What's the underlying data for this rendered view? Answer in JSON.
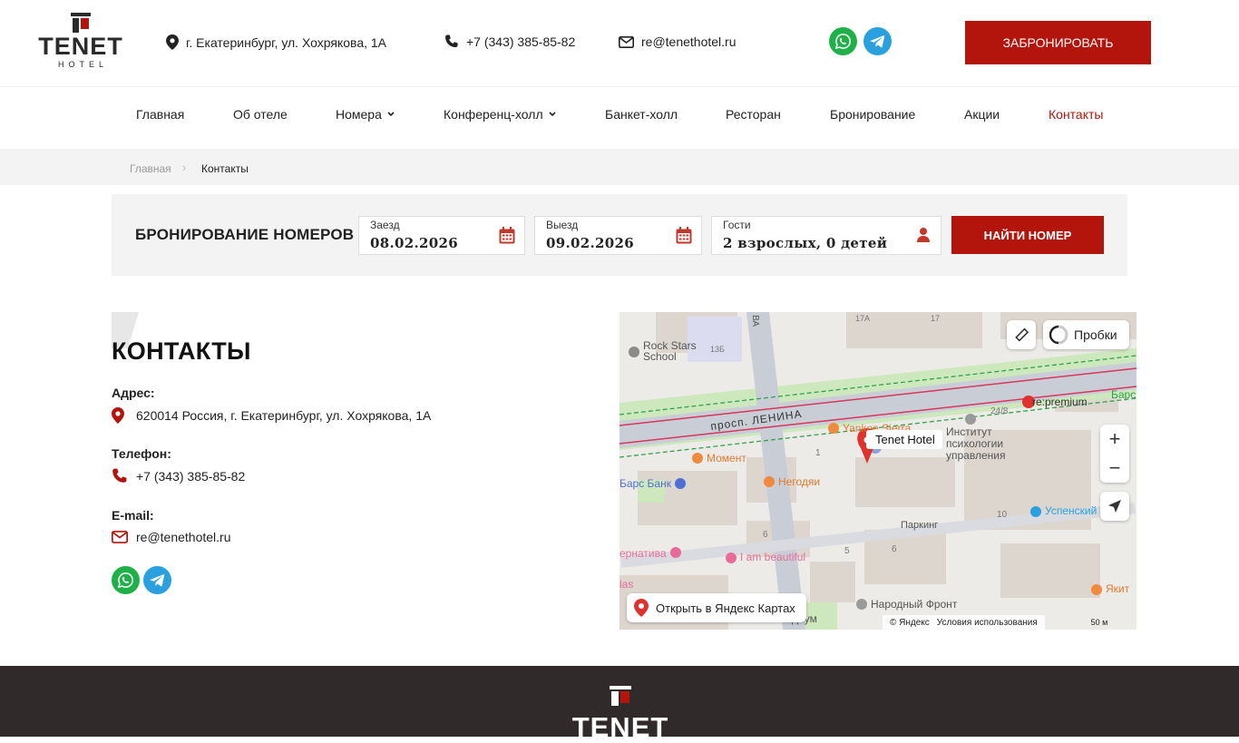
{
  "header": {
    "logo_word": "TENET",
    "logo_sub": "HOTEL",
    "address": "г. Екатеринбург, ул. Хохрякова, 1А",
    "phone": "+7 (343) 385-85-82",
    "email": "re@tenethotel.ru",
    "book_label": "ЗАБРОНИРОВАТЬ",
    "icons": [
      "map-pin-icon",
      "phone-icon",
      "mail-icon",
      "whatsapp-icon",
      "telegram-icon"
    ]
  },
  "nav": {
    "items": [
      {
        "label": "Главная"
      },
      {
        "label": "Об отеле"
      },
      {
        "label": "Номера"
      },
      {
        "label": "Конференц-холл"
      },
      {
        "label": "Банкет-холл"
      },
      {
        "label": "Ресторан"
      },
      {
        "label": "Бронирование"
      },
      {
        "label": "Акции"
      },
      {
        "label": "Контакты"
      }
    ],
    "active": "Контакты"
  },
  "breadcrumb": {
    "home": "Главная",
    "current": "Контакты"
  },
  "booking": {
    "title": "БРОНИРОВАНИЕ НОМЕРОВ",
    "checkin_label": "Заезд",
    "checkin_value": "08.02.2026",
    "checkout_label": "Выезд",
    "checkout_value": "09.02.2026",
    "guests_label": "Гости",
    "guests_value": "2 взрослых, 0 детей",
    "find_label": "НАЙТИ НОМЕР"
  },
  "contacts": {
    "title": "КОНТАКТЫ",
    "address_label": "Адрес:",
    "address": "620014 Россия, г. Екатеринбург, ул. Хохрякова, 1А",
    "phone_label": "Телефон:",
    "phone": "+7 (343) 385-85-82",
    "email_label": "E-mail:",
    "email": "re@tenethotel.ru"
  },
  "map": {
    "traffic_label": "Пробки",
    "open_label": "Открыть в Яндекс Картах",
    "copyright": "© Яндекс",
    "terms": "Условия использования",
    "scale": "50 м",
    "marker": "Tenet Hotel",
    "street": "просп. ЛЕНИНА",
    "places": [
      "Rock Stars School",
      "re:premium",
      "Yankee Sierra",
      "Институт психологии управления",
      "Момент",
      "Барс Банк",
      "Негодяи",
      "Паркинг",
      "Успенский",
      "I am beautiful",
      "Народный Фронт",
      "Якит",
      "Барс",
      "ернатива",
      "диум",
      "las"
    ],
    "numbers": [
      "13Б",
      "17А",
      "17",
      "24/8",
      "1",
      "6",
      "5",
      "6",
      "10",
      "ВА"
    ],
    "accent": "#e0322d"
  },
  "colors": {
    "accent": "#b3140b",
    "footer": "#302a2b",
    "whatsapp": "#1fb148",
    "telegram": "#2aa0de"
  },
  "footer": {
    "logo_word": "TENET"
  }
}
